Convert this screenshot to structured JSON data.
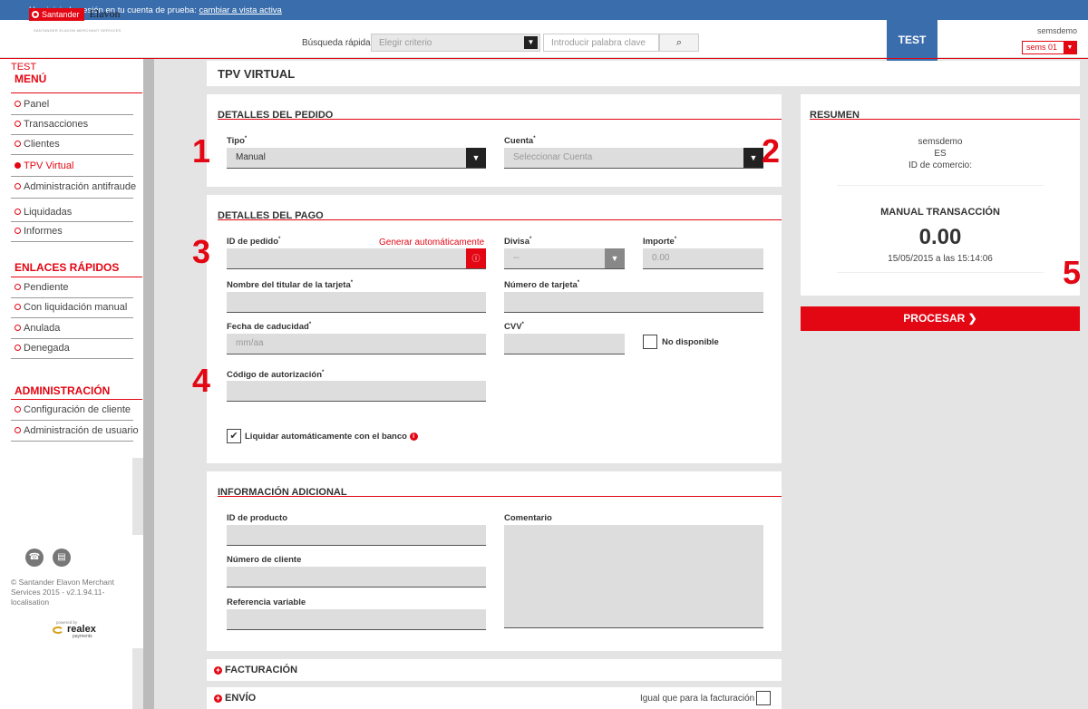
{
  "topbar": {
    "message": "Has iniciado sesión en tu cuenta de prueba: ",
    "link": "cambiar a vista activa"
  },
  "header": {
    "logo_santander": "Santander",
    "logo_elavon": "Elavon",
    "logo_sub": "SANTANDER ELAVON MERCHANT SERVICES",
    "quick_search_label": "Búsqueda rápida:",
    "criteria_placeholder": "Elegir criterio",
    "keyword_placeholder": "Introducir palabra clave",
    "env_flag": "TEST",
    "username": "semsdemo",
    "account_select": "sems 01"
  },
  "sidebar": {
    "env": "TEST",
    "menu_title": "MENÚ",
    "menu_items": [
      {
        "label": "Panel"
      },
      {
        "label": "Transacciones"
      },
      {
        "label": "Clientes"
      },
      {
        "label": "TPV Virtual"
      },
      {
        "label": "Administración antifraude"
      },
      {
        "label": "Liquidadas"
      },
      {
        "label": "Informes"
      }
    ],
    "quick_links_title": "ENLACES RÁPIDOS",
    "quick_links": [
      {
        "label": "Pendiente"
      },
      {
        "label": "Con liquidación manual"
      },
      {
        "label": "Anulada"
      },
      {
        "label": "Denegada"
      }
    ],
    "admin_title": "ADMINISTRACIÓN",
    "admin_items": [
      {
        "label": "Configuración de cliente"
      },
      {
        "label": "Administración de usuario"
      }
    ],
    "copyright": "© Santander Elavon Merchant Services 2015 - v2.1.94.11-localisation",
    "powered_by": "powered by",
    "realex": "realex",
    "realex_sub": "payments"
  },
  "page": {
    "title": "TPV VIRTUAL"
  },
  "order": {
    "title": "DETALLES DEL PEDIDO",
    "tipo_label": "Tipo",
    "tipo_value": "Manual",
    "cuenta_label": "Cuenta",
    "cuenta_placeholder": "Seleccionar Cuenta"
  },
  "payment": {
    "title": "DETALLES DEL PAGO",
    "order_id_label": "ID de pedido",
    "auto_generate": "Generar automáticamente",
    "currency_label": "Divisa",
    "currency_value": "--",
    "amount_label": "Importe",
    "amount_placeholder": "0.00",
    "holder_label": "Nombre del titular de la tarjeta",
    "card_label": "Número de tarjeta",
    "expiry_label": "Fecha de caducidad",
    "expiry_placeholder": "mm/aa",
    "cvv_label": "CVV",
    "not_available": "No disponible",
    "auth_label": "Código de autorización",
    "auto_settle": "Liquidar automáticamente con el banco"
  },
  "additional": {
    "title": "INFORMACIÓN ADICIONAL",
    "product_label": "ID de producto",
    "comment_label": "Comentario",
    "customer_label": "Número de cliente",
    "reference_label": "Referencia variable"
  },
  "billing": {
    "title": "FACTURACIÓN"
  },
  "shipping": {
    "title": "ENVÍO",
    "same_as_billing": "Igual que para la facturación"
  },
  "summary": {
    "title": "RESUMEN",
    "user": "semsdemo",
    "country": "ES",
    "merchant_id": "ID de comercio:",
    "transaction_title": "MANUAL TRANSACCIÓN",
    "amount": "0.00",
    "datetime": "15/05/2015 a las 15:14:06",
    "process_button": "PROCESAR"
  },
  "callouts": [
    "1",
    "2",
    "3",
    "4",
    "5"
  ],
  "colors": {
    "brand_red": "#e30613",
    "top_blue": "#3a6dac"
  }
}
